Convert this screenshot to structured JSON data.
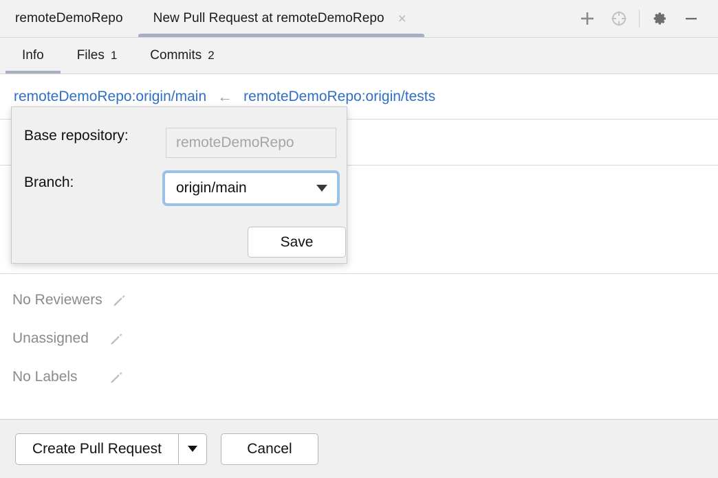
{
  "window": {
    "tabs": [
      {
        "label": "remoteDemoRepo",
        "active": false,
        "closable": false
      },
      {
        "label": "New Pull Request at remoteDemoRepo",
        "active": true,
        "closable": true
      }
    ],
    "close_glyph": "×",
    "actions": [
      {
        "name": "add-button",
        "icon": "plus-icon",
        "label": "+"
      },
      {
        "name": "locate-button",
        "icon": "crosshair-icon",
        "label": ""
      },
      {
        "name": "settings-button",
        "icon": "gear-icon",
        "label": ""
      },
      {
        "name": "minimize-button",
        "icon": "minimize-icon",
        "label": "−"
      }
    ]
  },
  "subtabs": [
    {
      "label": "Info",
      "count": "",
      "active": true
    },
    {
      "label": "Files",
      "count": "1",
      "active": false
    },
    {
      "label": "Commits",
      "count": "2",
      "active": false
    }
  ],
  "branch_row": {
    "base_link": "remoteDemoRepo:origin/main",
    "arrow": "←",
    "head_link": "remoteDemoRepo:origin/tests"
  },
  "meta": [
    {
      "label": "No Reviewers",
      "name": "reviewers",
      "edit_icon": "pencil-icon"
    },
    {
      "label": "Unassigned",
      "name": "assignee",
      "edit_icon": "pencil-icon"
    },
    {
      "label": "No Labels",
      "name": "labels",
      "edit_icon": "pencil-icon"
    }
  ],
  "popup": {
    "base_repository_label": "Base repository:",
    "base_repository_value": "remoteDemoRepo",
    "branch_label": "Branch:",
    "branch_value": "origin/main",
    "save_label": "Save"
  },
  "bottombar": {
    "create_label": "Create Pull Request",
    "cancel_label": "Cancel"
  },
  "colors": {
    "link": "#2f6fc4",
    "tab_underline": "#a7b0c0",
    "focus_ring": "#8cb8e6",
    "muted_text": "#8b8b8b",
    "chrome_bg": "#f2f2f2",
    "bottom_bg": "#f0f0f0",
    "popup_bg": "#f0f0f0"
  }
}
